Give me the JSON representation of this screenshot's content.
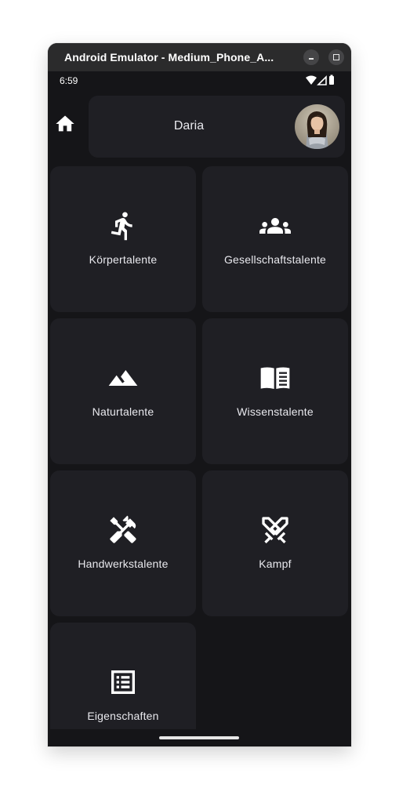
{
  "window": {
    "title": "Android Emulator - Medium_Phone_A..."
  },
  "status_bar": {
    "time": "6:59"
  },
  "profile": {
    "name": "Daria"
  },
  "categories": [
    {
      "label": "Körpertalente",
      "icon": "run-icon"
    },
    {
      "label": "Gesellschaftstalente",
      "icon": "groups-icon"
    },
    {
      "label": "Naturtalente",
      "icon": "mountains-icon"
    },
    {
      "label": "Wissenstalente",
      "icon": "book-icon"
    },
    {
      "label": "Handwerkstalente",
      "icon": "tools-icon"
    },
    {
      "label": "Kampf",
      "icon": "swords-icon"
    },
    {
      "label": "Eigenschaften",
      "icon": "list-icon"
    }
  ],
  "colors": {
    "screen_background": "#151518",
    "tile_background": "#1f1f24",
    "titlebar": "#2b2b2c",
    "text": "#e9e9ee"
  }
}
